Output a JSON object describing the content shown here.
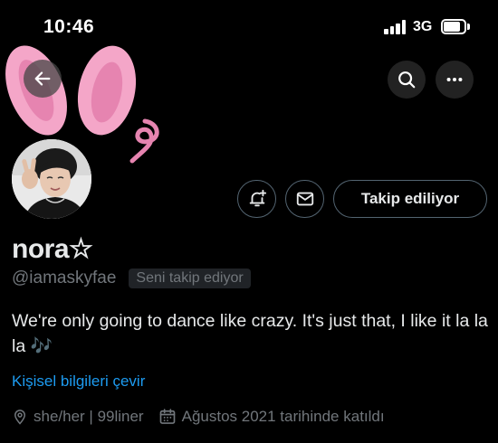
{
  "status_bar": {
    "time": "10:46",
    "network": "3G"
  },
  "profile": {
    "name": "nora☆",
    "handle": "@iamaskyfae",
    "follows_you_badge": "Seni takip ediyor",
    "bio": "We're only going to dance like crazy. It's just that, I like it la la la 🎶",
    "translate_link": "Kişisel bilgileri çevir",
    "pronouns": "she/her | 99liner",
    "joined": "Ağustos 2021 tarihinde katıldı"
  },
  "actions": {
    "follow_label": "Takip ediliyor"
  },
  "icons": {
    "back": "back-arrow-icon",
    "search": "search-icon",
    "more": "more-icon",
    "notify": "bell-plus-icon",
    "message": "mail-icon",
    "location": "location-pin-icon",
    "calendar": "calendar-icon"
  },
  "colors": {
    "background": "#000000",
    "link": "#1d9bf0",
    "secondary_text": "#71767b",
    "banner_pink": "#f4a6c8"
  }
}
